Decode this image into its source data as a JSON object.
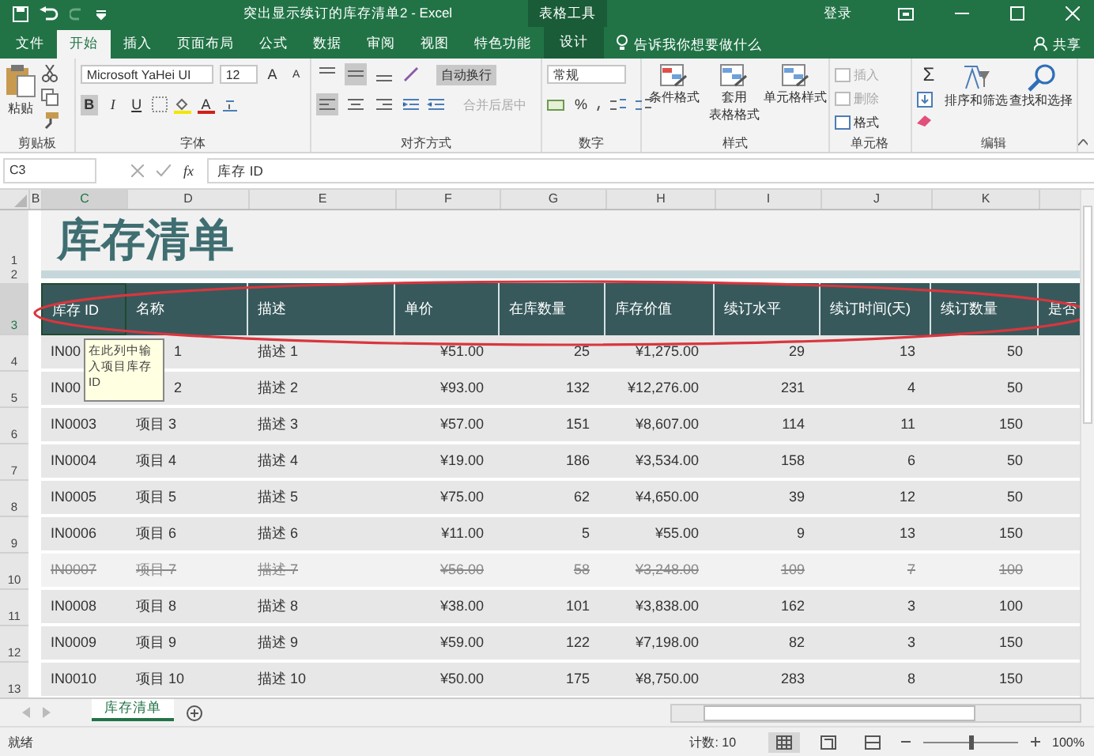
{
  "title_bar": {
    "title": "突出显示续订的库存清单2 - Excel",
    "context": "表格工具",
    "sign_in": "登录"
  },
  "ribbon_tabs": [
    {
      "label": "文件",
      "selected": false,
      "kind": "normal"
    },
    {
      "label": "开始",
      "selected": true,
      "kind": "normal"
    },
    {
      "label": "插入",
      "selected": false,
      "kind": "normal"
    },
    {
      "label": "页面布局",
      "selected": false,
      "kind": "normal"
    },
    {
      "label": "公式",
      "selected": false,
      "kind": "normal"
    },
    {
      "label": "数据",
      "selected": false,
      "kind": "normal"
    },
    {
      "label": "审阅",
      "selected": false,
      "kind": "normal"
    },
    {
      "label": "视图",
      "selected": false,
      "kind": "normal"
    },
    {
      "label": "特色功能",
      "selected": false,
      "kind": "normal"
    },
    {
      "label": "设计",
      "selected": false,
      "kind": "context"
    }
  ],
  "tell_me": "告诉我你想要做什么",
  "share": "共享",
  "ribbon": {
    "clipboard": {
      "label": "剪贴板",
      "paste": "粘贴"
    },
    "font": {
      "label": "字体",
      "name": "Microsoft YaHei UI",
      "size": "12",
      "grow": "A",
      "shrink": "A",
      "bold": "B",
      "italic": "I",
      "underline": "U",
      "font_color": "A",
      "bold_on": true
    },
    "alignment": {
      "label": "对齐方式",
      "wrap": "自动换行",
      "wrap_on": true,
      "merge": "合并后居中",
      "merge_disabled": true,
      "vertical_align": [
        {
          "selected": false
        },
        {
          "selected": true
        },
        {
          "selected": false
        }
      ],
      "horizontal_align": [
        {
          "selected": true
        },
        {
          "selected": false
        },
        {
          "selected": false
        }
      ]
    },
    "number": {
      "label": "数字",
      "format": "常规",
      "percent": "%"
    },
    "styles": {
      "label": "样式",
      "buttons": [
        {
          "lines": [
            "条件格式"
          ]
        },
        {
          "lines": [
            "套用",
            "表格格式"
          ]
        },
        {
          "lines": [
            "单元格样式"
          ]
        }
      ]
    },
    "cells": {
      "label": "单元格",
      "buttons": [
        {
          "label": "插入",
          "disabled": true
        },
        {
          "label": "删除",
          "disabled": true
        },
        {
          "label": "格式",
          "disabled": false
        }
      ]
    },
    "editing": {
      "label": "编辑",
      "sum": "Σ",
      "buttons": [
        "排序和筛选",
        "查找和选择"
      ]
    }
  },
  "formula_bar": {
    "name_box": "C3",
    "fx": "fx",
    "value": "库存 ID"
  },
  "column_letters": [
    "B",
    "C",
    "D",
    "E",
    "F",
    "G",
    "H",
    "I",
    "J",
    "K"
  ],
  "row_numbers": [
    "1",
    "2",
    "3",
    "4",
    "5",
    "6",
    "7",
    "8",
    "9",
    "10",
    "11",
    "12",
    "13"
  ],
  "sheet_title": "库存清单",
  "table": {
    "columns": [
      {
        "label": "库存 ID",
        "numeric": false
      },
      {
        "label": "名称",
        "numeric": false
      },
      {
        "label": "描述",
        "numeric": false
      },
      {
        "label": "单价",
        "numeric": true
      },
      {
        "label": "在库数量",
        "numeric": true
      },
      {
        "label": "库存价值",
        "numeric": true
      },
      {
        "label": "续订水平",
        "numeric": true
      },
      {
        "label": "续订时间(天)",
        "numeric": true
      },
      {
        "label": "续订数量",
        "numeric": true
      },
      {
        "label": "是否"
      }
    ],
    "rows": [
      {
        "cells": [
          "IN00",
          "1",
          "描述 1",
          "¥51.00",
          "25",
          "¥1,275.00",
          "29",
          "13",
          "50"
        ],
        "discontinued": false
      },
      {
        "cells": [
          "IN00",
          "2",
          "描述 2",
          "¥93.00",
          "132",
          "¥12,276.00",
          "231",
          "4",
          "50"
        ],
        "discontinued": false
      },
      {
        "cells": [
          "IN0003",
          "项目 3",
          "描述 3",
          "¥57.00",
          "151",
          "¥8,607.00",
          "114",
          "11",
          "150"
        ],
        "discontinued": false
      },
      {
        "cells": [
          "IN0004",
          "项目 4",
          "描述 4",
          "¥19.00",
          "186",
          "¥3,534.00",
          "158",
          "6",
          "50"
        ],
        "discontinued": false
      },
      {
        "cells": [
          "IN0005",
          "项目 5",
          "描述 5",
          "¥75.00",
          "62",
          "¥4,650.00",
          "39",
          "12",
          "50"
        ],
        "discontinued": false
      },
      {
        "cells": [
          "IN0006",
          "项目 6",
          "描述 6",
          "¥11.00",
          "5",
          "¥55.00",
          "9",
          "13",
          "150"
        ],
        "discontinued": false
      },
      {
        "cells": [
          "IN0007",
          "项目 7",
          "描述 7",
          "¥56.00",
          "58",
          "¥3,248.00",
          "109",
          "7",
          "100"
        ],
        "discontinued": true
      },
      {
        "cells": [
          "IN0008",
          "项目 8",
          "描述 8",
          "¥38.00",
          "101",
          "¥3,838.00",
          "162",
          "3",
          "100"
        ],
        "discontinued": false
      },
      {
        "cells": [
          "IN0009",
          "项目 9",
          "描述 9",
          "¥59.00",
          "122",
          "¥7,198.00",
          "82",
          "3",
          "150"
        ],
        "discontinued": false
      },
      {
        "cells": [
          "IN0010",
          "项目 10",
          "描述 10",
          "¥50.00",
          "175",
          "¥8,750.00",
          "283",
          "8",
          "150"
        ],
        "discontinued": false
      }
    ]
  },
  "tooltip": "在此列中输入项目库存 ID",
  "sheet_tabs": [
    {
      "label": "库存清单",
      "selected": true
    }
  ],
  "status_bar": {
    "status": "就绪",
    "count": "计数: 10",
    "zoom": "100%",
    "zoom_slider": {
      "level": 0.5
    }
  }
}
